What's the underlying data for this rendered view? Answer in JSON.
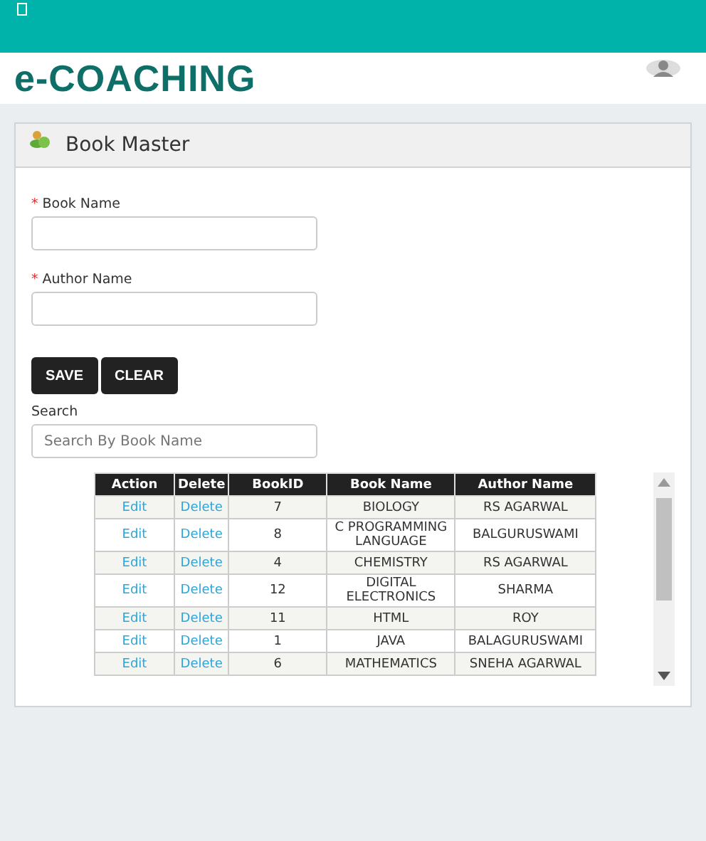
{
  "app": {
    "title": "e-COACHING"
  },
  "panel": {
    "title": "Book Master"
  },
  "form": {
    "fields": [
      {
        "label": "Book Name",
        "mark": "*"
      },
      {
        "label": "Author Name",
        "mark": "*"
      }
    ],
    "buttons": [
      "SAVE",
      "CLEAR"
    ],
    "search": {
      "label": "Search",
      "placeholder": "Search By Book Name"
    }
  },
  "table": {
    "columns": [
      "Action",
      "Delete",
      "BookID",
      "Book Name",
      "Author Name"
    ],
    "rows": [
      {
        "action": "Edit",
        "delete": "Delete",
        "id": "7",
        "book": "BIOLOGY",
        "author": "RS AGARWAL"
      },
      {
        "action": "Edit",
        "delete": "Delete",
        "id": "8",
        "book": "C PROGRAMMING LANGUAGE",
        "author": "BALGURUSWAMI"
      },
      {
        "action": "Edit",
        "delete": "Delete",
        "id": "4",
        "book": "CHEMISTRY",
        "author": "RS AGARWAL"
      },
      {
        "action": "Edit",
        "delete": "Delete",
        "id": "12",
        "book": "DIGITAL ELECTRONICS",
        "author": "SHARMA"
      },
      {
        "action": "Edit",
        "delete": "Delete",
        "id": "11",
        "book": "HTML",
        "author": "ROY"
      },
      {
        "action": "Edit",
        "delete": "Delete",
        "id": "1",
        "book": "JAVA",
        "author": "BALAGURUSWAMI"
      },
      {
        "action": "Edit",
        "delete": "Delete",
        "id": "6",
        "book": "MATHEMATICS",
        "author": "SNEHA AGARWAL"
      }
    ]
  }
}
